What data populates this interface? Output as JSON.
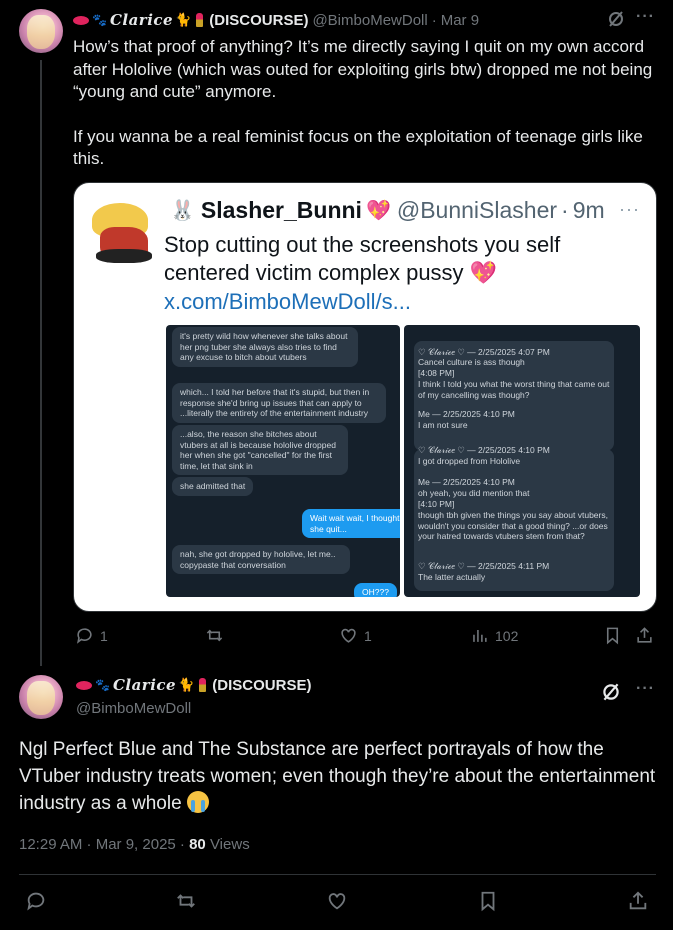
{
  "post1": {
    "display_name": "(DISCOURSE)",
    "fancy_name": "Clarice",
    "handle": "@BimboMewDoll",
    "separator": "·",
    "time": "Mar 9",
    "paragraphs": [
      "How’s that proof of anything?  It’s me directly saying I quit on my own accord after Hololive (which was outed for exploiting girls btw) dropped me not being “young and cute” anymore.",
      "If you wanna be a real feminist focus on the exploitation of teenage girls like this."
    ],
    "quote": {
      "name": "Slasher_Bunni",
      "handle": "@BunniSlasher",
      "time": "9m",
      "text": "Stop cutting out the screenshots you self centered victim complex pussy",
      "link": "x.com/BimboMewDoll/s...",
      "left_chat": [
        "it's pretty wild how whenever she talks about her png tuber she always also tries to find any excuse to bitch about vtubers",
        "which... I told her before that it's stupid, but then in response she'd bring up issues that can apply to ...literally the entirety of the entertainment industry",
        "...also, the reason she bitches about vtubers at all is because hololive dropped her when she got \"cancelled\" for the first time, let that sink in",
        "she admitted that",
        "Wait wait wait, I thought it was because she quit...",
        "nah, she got dropped by hololive, let me.. copypaste that conversation",
        "OH???"
      ],
      "right_chat": [
        "♡ 𝒞𝓁𝒶𝓇𝒾𝒸𝑒 ♡ — 2/25/2025 4:07 PM",
        "Cancel culture is ass though",
        "[4:08 PM]",
        "I think I told you what the worst thing that came out of my cancelling was though?",
        "Me — 2/25/2025 4:10 PM",
        "I am not sure",
        "♡ 𝒞𝓁𝒶𝓇𝒾𝒸𝑒 ♡ — 2/25/2025 4:10 PM",
        "I got dropped from Hololive",
        "Me — 2/25/2025 4:10 PM",
        "oh yeah, you did mention that",
        "[4:10 PM]",
        "though tbh given the things you say about vtubers, wouldn't you consider that a good thing? ...or does your hatred towards vtubers stem from that?",
        "♡ 𝒞𝓁𝒶𝓇𝒾𝒸𝑒 ♡ — 2/25/2025 4:11 PM",
        "The latter actually"
      ]
    },
    "actions": {
      "replies": "1",
      "reposts": "",
      "likes": "1",
      "views": "102"
    }
  },
  "post2": {
    "display_name": "(DISCOURSE)",
    "fancy_name": "Clarice",
    "handle": "@BimboMewDoll",
    "text": "Ngl Perfect Blue and The Substance are perfect portrayals of how the VTuber industry treats women; even though they’re about the entertainment industry as a whole",
    "timestamp": "12:29 AM · Mar 9, 2025 · ",
    "views_count": "80",
    "views_label": " Views"
  },
  "icons": {
    "reply": "reply-icon",
    "repost": "repost-icon",
    "like": "heart-icon",
    "views": "views-icon",
    "bookmark": "bookmark-icon",
    "share": "share-icon",
    "grok": "grok-icon",
    "more": "more-icon"
  },
  "colors": {
    "background": "#000000",
    "text": "#e7e9ea",
    "muted": "#71767b",
    "divider": "#2f3336",
    "accent_pink": "#e0245e"
  }
}
